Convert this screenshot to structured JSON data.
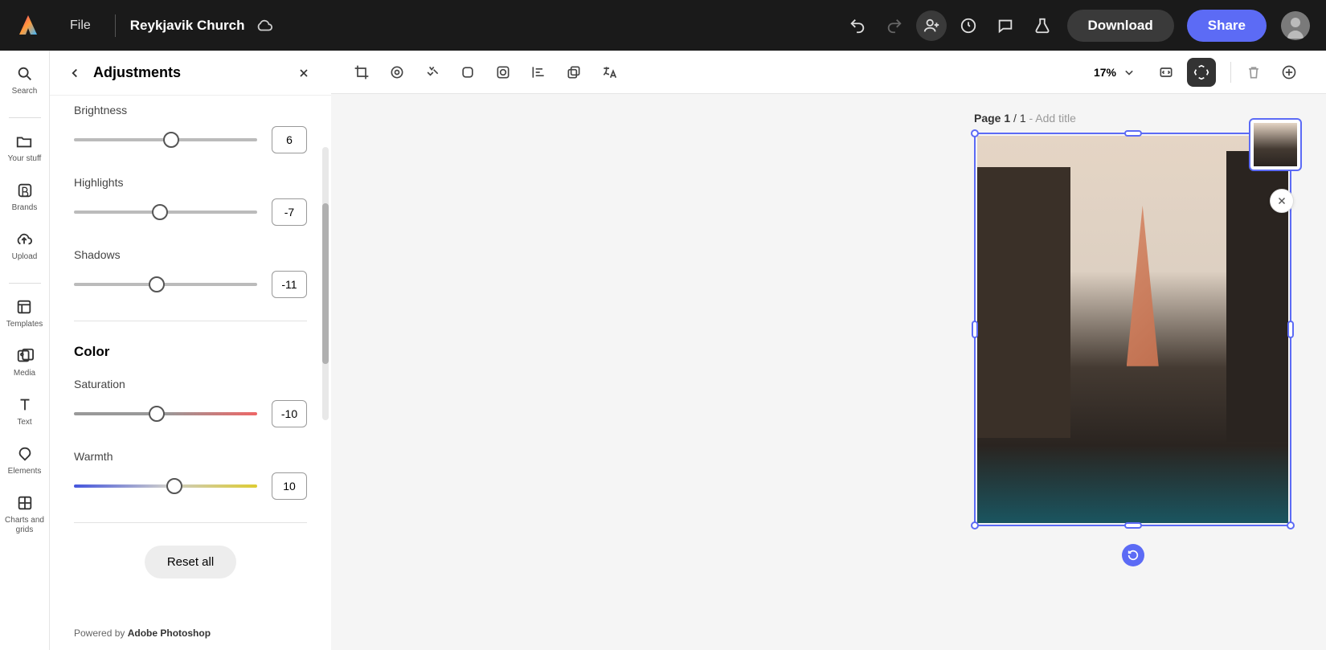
{
  "topbar": {
    "file_label": "File",
    "project_name": "Reykjavik Church",
    "download_label": "Download",
    "share_label": "Share"
  },
  "rail": {
    "search": "Search",
    "your_stuff": "Your stuff",
    "brands": "Brands",
    "upload": "Upload",
    "templates": "Templates",
    "media": "Media",
    "text": "Text",
    "elements": "Elements",
    "charts": "Charts and grids"
  },
  "adjustments": {
    "title": "Adjustments",
    "light": {
      "brightness_label": "Brightness",
      "brightness_value": "6",
      "highlights_label": "Highlights",
      "highlights_value": "-7",
      "shadows_label": "Shadows",
      "shadows_value": "-11"
    },
    "color_section": "Color",
    "color": {
      "saturation_label": "Saturation",
      "saturation_value": "-10",
      "warmth_label": "Warmth",
      "warmth_value": "10"
    },
    "reset_label": "Reset all",
    "powered_prefix": "Powered by ",
    "powered_brand": "Adobe Photoshop"
  },
  "toolbar": {
    "zoom": "17%"
  },
  "canvas": {
    "page_prefix": "Page ",
    "page_current": "1",
    "page_sep": " / ",
    "page_total": "1",
    "page_dash": " - ",
    "add_title": "Add title"
  }
}
